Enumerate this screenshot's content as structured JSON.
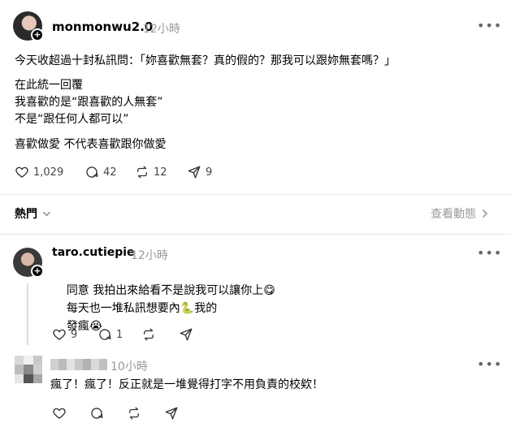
{
  "post": {
    "username": "monmonwu2.0",
    "time": "12小時",
    "lines": [
      "今天收超過十封私訊問：「妳喜歡無套？真的假的？那我可以跟妳無套嗎？」",
      "在此統一回覆",
      "我喜歡的是“跟喜歡的人無套”",
      "不是“跟任何人都可以”",
      "喜歡做愛 不代表喜歡跟你做愛"
    ],
    "likes": "1,029",
    "comments": "42",
    "reposts": "12",
    "shares": "9"
  },
  "sort": {
    "label": "熱門",
    "view_activity": "查看動態"
  },
  "reply1": {
    "username": "taro.cutiepie",
    "time": "12小時",
    "line1": "同意 我拍出來給看不是說我可以讓你上",
    "line2a": "每天也一堆私訊想要內",
    "line2b": "我的",
    "line3": "發瘋",
    "likes": "9",
    "comments": "1"
  },
  "reply2": {
    "time": "10小時",
    "text": "瘋了！瘋了！反正就是一堆覺得打字不用負責的校欸！"
  },
  "icons": {
    "heart": "heart-icon",
    "comment": "comment-icon",
    "repost": "repost-icon",
    "share": "send-icon",
    "more": "more-icon"
  }
}
